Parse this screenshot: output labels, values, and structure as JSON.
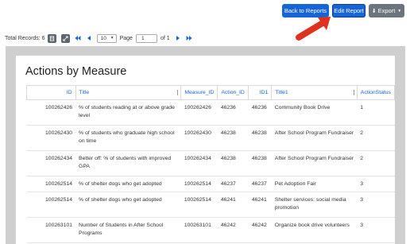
{
  "header": {
    "back_label": "Back to Reports",
    "edit_label": "Edit Report",
    "export_label": "Export",
    "accent": "#1565d8",
    "export_color": "#6c757d",
    "annotation_color": "#e0301e"
  },
  "toolbar": {
    "total_records": "Total Records: 6",
    "page_size": "10",
    "page_label": "Page",
    "page_value": "1",
    "of_label": "of 1"
  },
  "report": {
    "title": "Actions by Measure",
    "columns": [
      "ID",
      "Title",
      "Measure_ID",
      "Action_ID",
      "ID1",
      "Title1",
      "ActionStatus"
    ],
    "rows": [
      [
        "100262426",
        "% of students reading at or above grade level",
        "100262426",
        "46236",
        "46236",
        "Community Book Drive",
        "1"
      ],
      [
        "100262430",
        "% of students who graduate high school on time",
        "100262430",
        "46238",
        "46238",
        "After School Program Fundraiser",
        "2"
      ],
      [
        "100262434",
        "Better off: % of students with improved GPA",
        "100262434",
        "46238",
        "46238",
        "After School Program Fundraiser",
        "2"
      ],
      [
        "100262514",
        "% of shelter dogs who get adopted",
        "100262514",
        "46237",
        "46237",
        "Pet Adoption Fair",
        "3"
      ],
      [
        "100262514",
        "% of shelter dogs who get adopted",
        "100262514",
        "46241",
        "46241",
        "Shelter services: social media promotion",
        "3"
      ],
      [
        "100263101",
        "Number of Students in After School Programs",
        "100263101",
        "46242",
        "46242",
        "Organize book drive volunteers",
        "3"
      ]
    ]
  }
}
